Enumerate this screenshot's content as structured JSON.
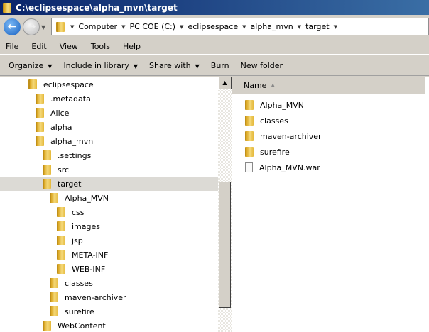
{
  "window": {
    "title": "C:\\eclipsespace\\alpha_mvn\\target"
  },
  "address": {
    "crumbs": [
      "Computer",
      "PC COE (C:)",
      "eclipsespace",
      "alpha_mvn",
      "target"
    ]
  },
  "menu": [
    "File",
    "Edit",
    "View",
    "Tools",
    "Help"
  ],
  "commands": [
    {
      "label": "Organize",
      "dropdown": true
    },
    {
      "label": "Include in library",
      "dropdown": true
    },
    {
      "label": "Share with",
      "dropdown": true
    },
    {
      "label": "Burn",
      "dropdown": false
    },
    {
      "label": "New folder",
      "dropdown": false
    }
  ],
  "tree": [
    {
      "label": "eclipsespace",
      "level": 0
    },
    {
      "label": ".metadata",
      "level": 1
    },
    {
      "label": "Alice",
      "level": 1
    },
    {
      "label": "alpha",
      "level": 1
    },
    {
      "label": "alpha_mvn",
      "level": 1
    },
    {
      "label": ".settings",
      "level": 2
    },
    {
      "label": "src",
      "level": 2
    },
    {
      "label": "target",
      "level": 2,
      "selected": true
    },
    {
      "label": "Alpha_MVN",
      "level": 3
    },
    {
      "label": "css",
      "level": 4
    },
    {
      "label": "images",
      "level": 4
    },
    {
      "label": "jsp",
      "level": 4
    },
    {
      "label": "META-INF",
      "level": 4
    },
    {
      "label": "WEB-INF",
      "level": 4
    },
    {
      "label": "classes",
      "level": 3
    },
    {
      "label": "maven-archiver",
      "level": 3
    },
    {
      "label": "surefire",
      "level": 3
    },
    {
      "label": "WebContent",
      "level": 2
    }
  ],
  "list": {
    "column": "Name",
    "items": [
      {
        "label": "Alpha_MVN",
        "type": "folder"
      },
      {
        "label": "classes",
        "type": "folder"
      },
      {
        "label": "maven-archiver",
        "type": "folder"
      },
      {
        "label": "surefire",
        "type": "folder"
      },
      {
        "label": "Alpha_MVN.war",
        "type": "file"
      }
    ]
  }
}
